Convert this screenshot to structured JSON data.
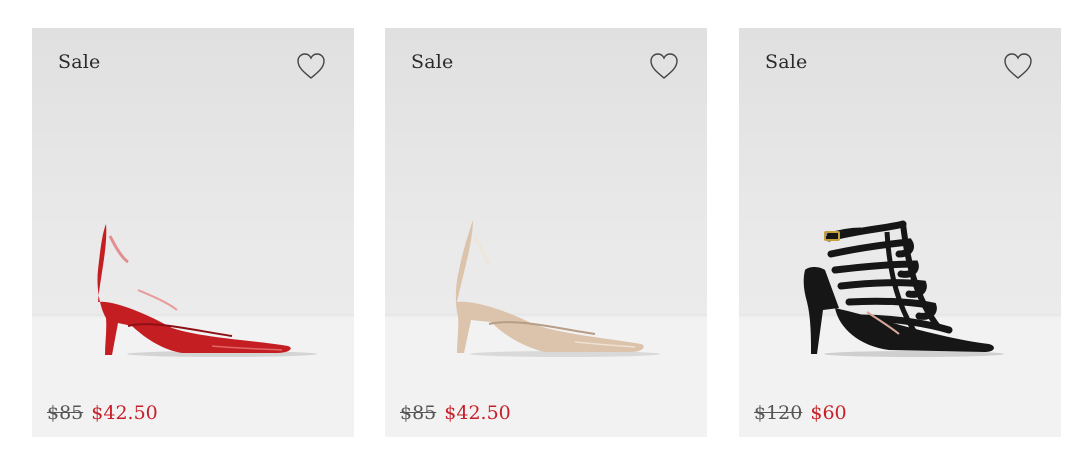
{
  "products": [
    {
      "badge": "Sale",
      "original_price": "$85",
      "sale_price": "$42.50",
      "shoe_color": "#c41e22",
      "favorite_icon": "heart-outline-icon"
    },
    {
      "badge": "Sale",
      "original_price": "$85",
      "sale_price": "$42.50",
      "shoe_color": "#dcc3ab",
      "favorite_icon": "heart-outline-icon"
    },
    {
      "badge": "Sale",
      "original_price": "$120",
      "sale_price": "$60",
      "shoe_color": "#161616",
      "favorite_icon": "heart-outline-icon"
    }
  ],
  "colors": {
    "sale_price": "#c8202a",
    "original_price": "#555555",
    "card_background": "#e6e6e6"
  }
}
